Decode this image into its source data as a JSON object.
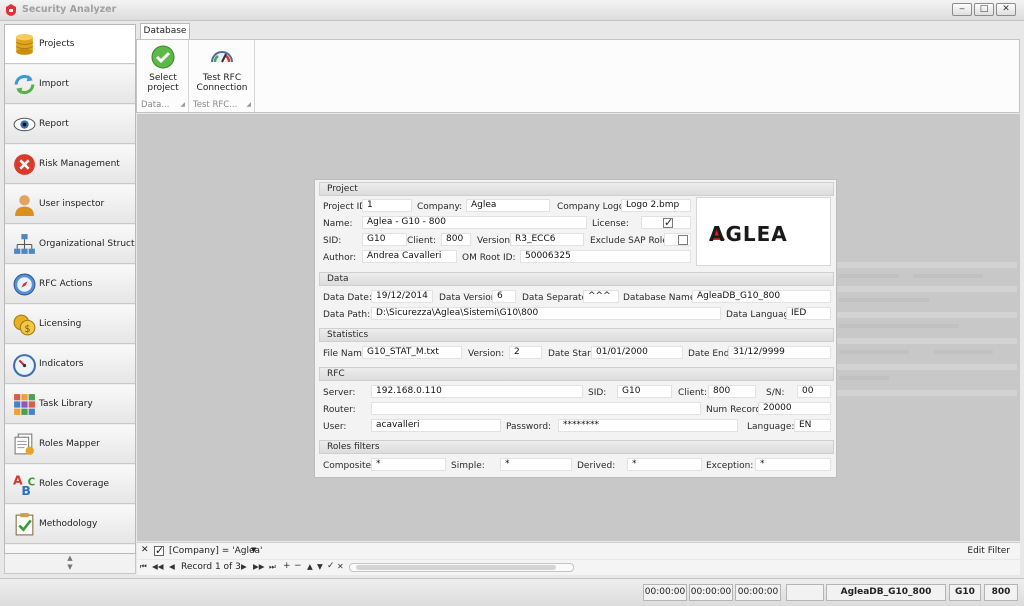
{
  "window": {
    "title": "Security Analyzer",
    "controls": {
      "minimize": "‒",
      "maximize": "□",
      "close": "✕"
    }
  },
  "nav": {
    "items": [
      {
        "label": "Projects",
        "icon": "database-icon"
      },
      {
        "label": "Import",
        "icon": "refresh-icon"
      },
      {
        "label": "Report",
        "icon": "eye-icon"
      },
      {
        "label": "Risk Management",
        "icon": "error-icon"
      },
      {
        "label": "User inspector",
        "icon": "user-icon"
      },
      {
        "label": "Organizational Structure",
        "icon": "org-chart-icon"
      },
      {
        "label": "RFC Actions",
        "icon": "compass-icon"
      },
      {
        "label": "Licensing",
        "icon": "coins-icon"
      },
      {
        "label": "Indicators",
        "icon": "gauge-icon"
      },
      {
        "label": "Task Library",
        "icon": "grid-icon"
      },
      {
        "label": "Roles Mapper",
        "icon": "document-stack-icon"
      },
      {
        "label": "Roles Coverage",
        "icon": "abc-icon"
      },
      {
        "label": "Methodology",
        "icon": "checklist-icon"
      }
    ],
    "scroll_up": "▲",
    "scroll_down": "▼"
  },
  "ribbon": {
    "tab": "Database",
    "groups": [
      {
        "button_line1": "Select",
        "button_line2": "project",
        "caption": "Data...",
        "icon": "check-circle-icon"
      },
      {
        "button_line1": "Test RFC",
        "button_line2": "Connection",
        "caption": "Test RFC...",
        "icon": "speedometer-icon"
      }
    ],
    "launcher": "◢"
  },
  "form": {
    "project": {
      "title": "Project",
      "project_id_label": "Project ID:",
      "project_id": "1",
      "company_label": "Company:",
      "company": "Aglea",
      "company_logo_label": "Company Logo:",
      "company_logo": "Logo 2.bmp",
      "name_label": "Name:",
      "name": "Aglea - G10 - 800",
      "license_label": "License:",
      "license_checked": true,
      "sid_label": "SID:",
      "sid": "G10",
      "client_label": "Client:",
      "client": "800",
      "version_label": "Version:",
      "version": "R3_ECC6",
      "exclude_sap_label": "Exclude SAP Roles:",
      "exclude_sap_checked": false,
      "author_label": "Author:",
      "author": "Andrea Cavalleri",
      "om_root_label": "OM Root ID:",
      "om_root": "50006325",
      "logo_text": "AGLEA"
    },
    "data": {
      "title": "Data",
      "data_date_label": "Data Date:",
      "data_date": "19/12/2014",
      "data_version_label": "Data Version:",
      "data_version": "6",
      "data_separator_label": "Data Separator:",
      "data_separator": "^^^",
      "database_name_label": "Database Name:",
      "database_name": "AgleaDB_G10_800",
      "data_path_label": "Data Path:",
      "data_path": "D:\\Sicurezza\\Aglea\\Sistemi\\G10\\800",
      "data_language_label": "Data Language:",
      "data_language": "IED"
    },
    "statistics": {
      "title": "Statistics",
      "file_name_label": "File Name:",
      "file_name": "G10_STAT_M.txt",
      "version_label": "Version:",
      "version": "2",
      "date_start_label": "Date Start:",
      "date_start": "01/01/2000",
      "date_end_label": "Date End:",
      "date_end": "31/12/9999"
    },
    "rfc": {
      "title": "RFC",
      "server_label": "Server:",
      "server": "192.168.0.110",
      "sid_label": "SID:",
      "sid": "G10",
      "client_label": "Client:",
      "client": "800",
      "sn_label": "S/N:",
      "sn": "00",
      "router_label": "Router:",
      "router": "",
      "num_records_label": "Num Records:",
      "num_records": "20000",
      "user_label": "User:",
      "user": "acavalleri",
      "password_label": "Password:",
      "password": "********",
      "language_label": "Language:",
      "language": "EN"
    },
    "roles_filters": {
      "title": "Roles filters",
      "composite_label": "Composite:",
      "composite": "*",
      "simple_label": "Simple:",
      "simple": "*",
      "derived_label": "Derived:",
      "derived": "*",
      "exception_label": "Exception:",
      "exception": "*"
    }
  },
  "filter": {
    "close": "✕",
    "expression": "[Company] = 'Aglea'",
    "dropdown": "▼",
    "edit": "Edit Filter"
  },
  "navigator": {
    "first": "⏮",
    "prev_page": "◀◀",
    "prev": "◀",
    "record": "Record 1 of 3",
    "next": "▶",
    "next_page": "▶▶",
    "last": "⏭",
    "add": "+",
    "remove": "−",
    "up": "▲",
    "down": "▼",
    "apply": "✓",
    "cancel": "✕",
    "scroll_left": "◂"
  },
  "status": {
    "timer1": "00:00:00",
    "timer2": "00:00:00",
    "timer3": "00:00:00",
    "database": "AgleaDB_G10_800",
    "sid": "G10",
    "client": "800"
  },
  "colors": {
    "brand_red": "#e42020",
    "workspace": "#c8c8c8"
  }
}
